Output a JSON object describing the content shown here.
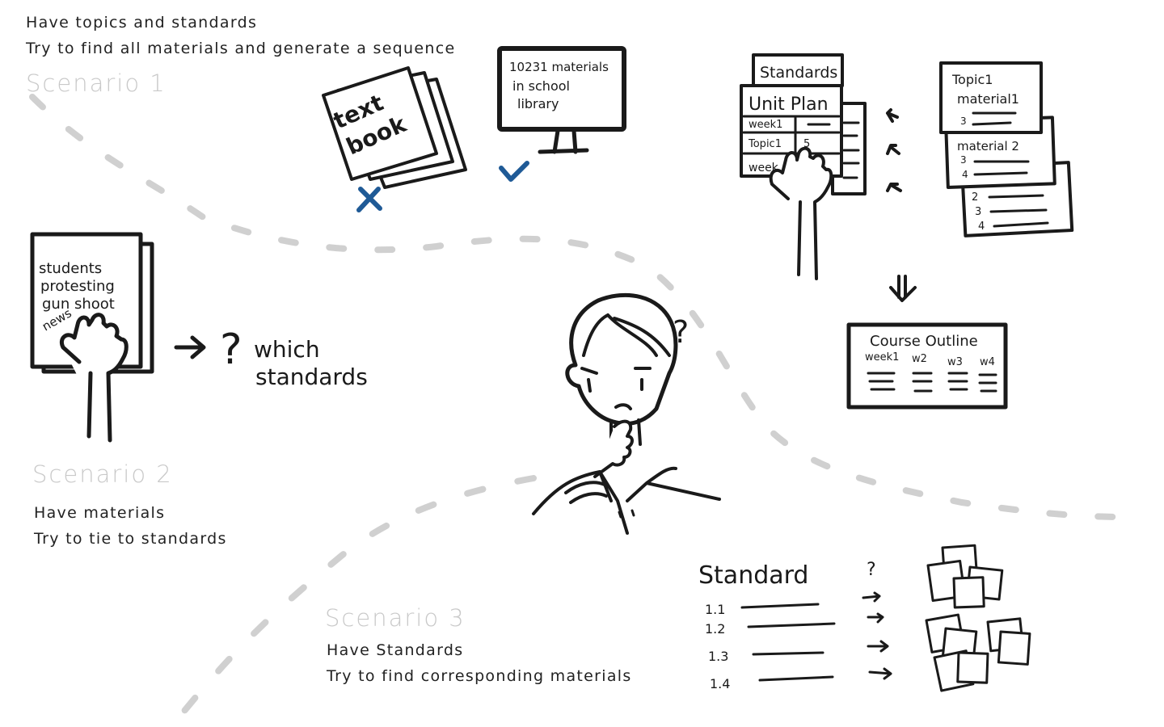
{
  "scenario1": {
    "title": "Scenario 1",
    "line1": "Have topics and standards",
    "line2": "Try to find all materials and generate a sequence"
  },
  "scenario2": {
    "title": "Scenario 2",
    "line1": "Have materials",
    "line2": "Try to tie to standards"
  },
  "scenario3": {
    "title": "Scenario 3",
    "line1": "Have Standards",
    "line2": "Try to find corresponding materials"
  },
  "sketch": {
    "textbook": {
      "line1": "text",
      "line2": "book"
    },
    "monitor": {
      "line1": "10231 materials",
      "line2": "in school",
      "line3": "library"
    },
    "newspaper": {
      "line1": "students",
      "line2": "protesting",
      "line3": "gun shoot",
      "line4": "news"
    },
    "which_standards": {
      "line1": "which",
      "line2": "standards"
    },
    "question_mark": "?",
    "standards_tab": "Standards",
    "unit_plan": {
      "title": "Unit Plan",
      "row1": "week1",
      "row2": "Topic1",
      "row2b": "5",
      "row3": "week"
    },
    "topic_cards": {
      "card1_title": "Topic1",
      "card1_sub": "material1",
      "card1_n": "3",
      "card2_title": "material 2",
      "card2_n1": "3",
      "card2_n2": "4",
      "card3_n1": "2",
      "card3_n2": "3",
      "card3_n3": "4"
    },
    "course_outline": {
      "title": "Course Outline",
      "col1": "week1",
      "col2": "w2",
      "col3": "w3",
      "col4": "w4"
    },
    "standard_list": {
      "title": "Standard",
      "items": [
        "1.1",
        "1.2",
        "1.3",
        "1.4"
      ],
      "question": "?"
    }
  },
  "colors": {
    "ink": "#1a1a1a",
    "faded_title": "#c9c9c9",
    "dash_path": "#d0d0d0",
    "mark_blue": "#1f5a96"
  }
}
